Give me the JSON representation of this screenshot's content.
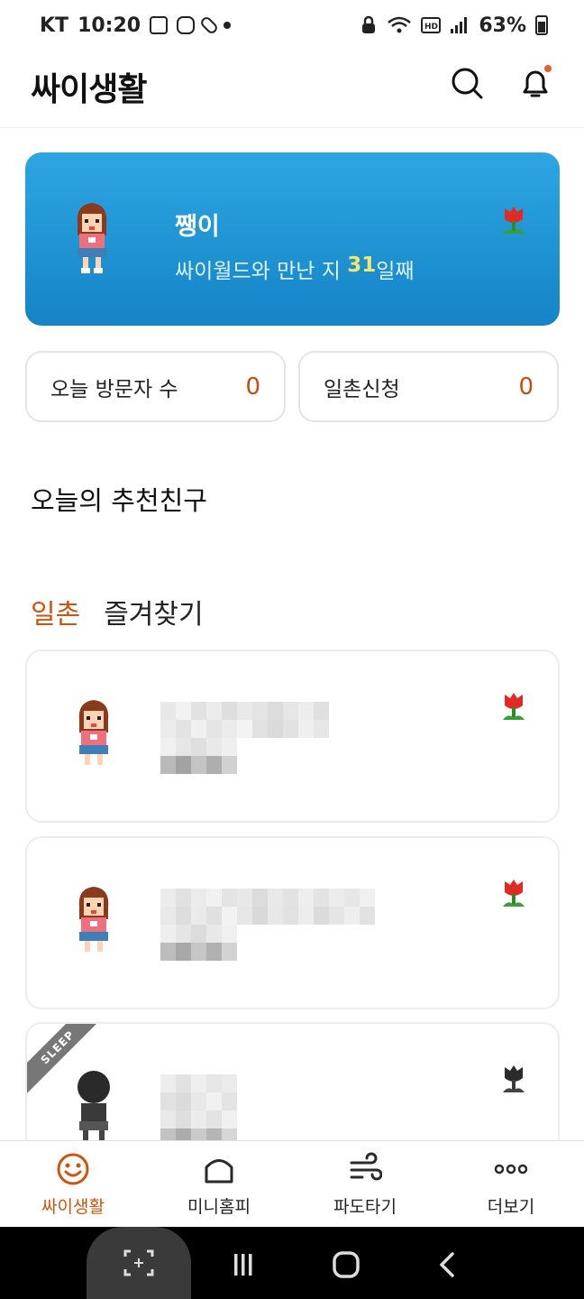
{
  "status": {
    "carrier": "KT",
    "time": "10:20",
    "battery": "63%"
  },
  "header": {
    "title": "싸이생활"
  },
  "profile": {
    "name": "쨍이",
    "days_prefix": "싸이월드와 만난 지 ",
    "days_count": "31",
    "days_suffix": "일째"
  },
  "stats": {
    "visitors_label": "오늘 방문자 수",
    "visitors_value": "0",
    "ilchon_label": "일촌신청",
    "ilchon_value": "0"
  },
  "recommend": {
    "title": "오늘의 추천친구"
  },
  "tabs": [
    {
      "label": "일촌",
      "active": true
    },
    {
      "label": "즐겨찾기",
      "active": false
    }
  ],
  "friends": [
    {
      "sleep": false
    },
    {
      "sleep": false
    },
    {
      "sleep": true,
      "badge": "SLEEP"
    }
  ],
  "bottom_nav": [
    {
      "label": "싸이생활",
      "icon": "smile-icon",
      "active": true
    },
    {
      "label": "미니홈피",
      "icon": "home-icon",
      "active": false,
      "highlighted": true
    },
    {
      "label": "파도타기",
      "icon": "wave-icon",
      "active": false
    },
    {
      "label": "더보기",
      "icon": "more-dots-icon",
      "active": false
    }
  ],
  "colors": {
    "accent": "#d0530f",
    "card_blue": "#1e96d6",
    "highlight_border": "#e0251c",
    "highlight_fill": "#fdfdc8"
  }
}
